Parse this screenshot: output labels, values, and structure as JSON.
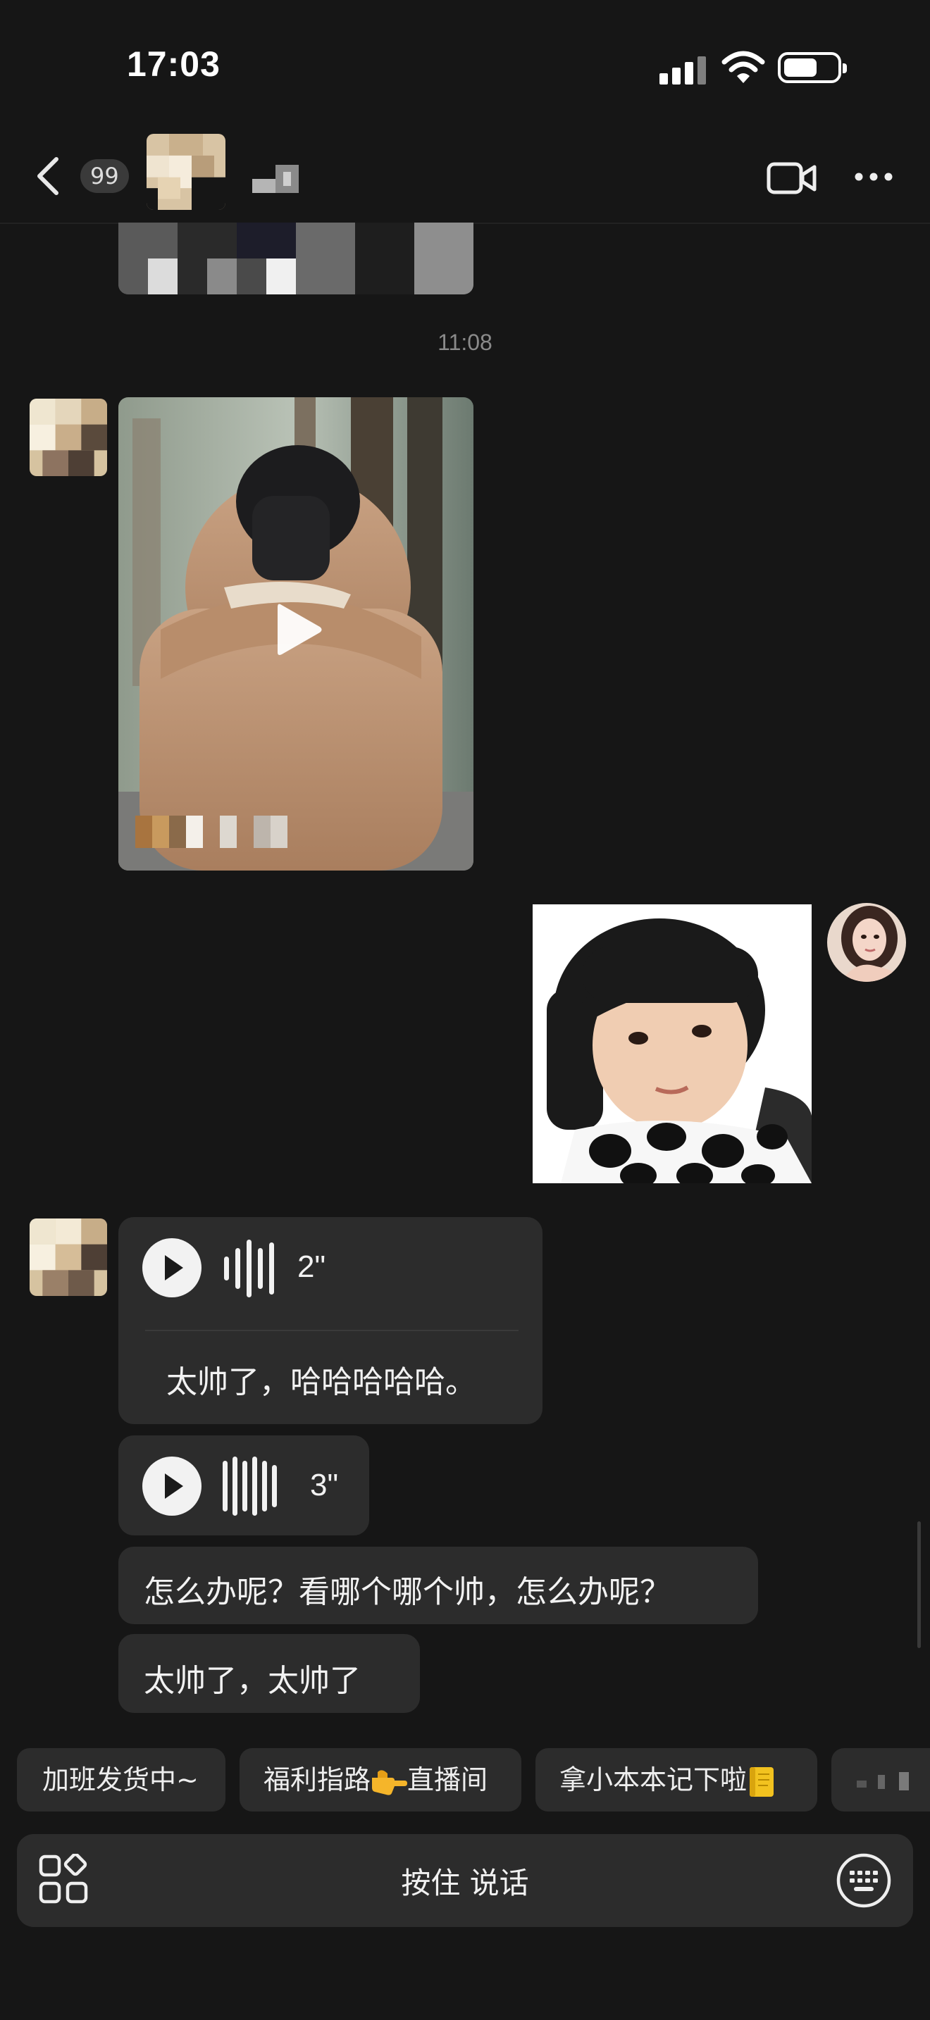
{
  "status_bar": {
    "time": "17:03"
  },
  "header": {
    "unread_count": "99"
  },
  "chat": {
    "timestamp": "11:08",
    "voice_1": {
      "duration": "2\"",
      "transcript": "太帅了，哈哈哈哈哈。"
    },
    "voice_2": {
      "duration": "3\""
    },
    "text_1": "怎么办呢？看哪个哪个帅，怎么办呢？",
    "text_2": "太帅了，太帅了"
  },
  "quick_replies": [
    {
      "label": "加班发货中~"
    },
    {
      "label": "福利指路",
      "label_after": "直播间",
      "emoji": "pointing-hand-icon"
    },
    {
      "label": "拿小本本记下啦",
      "emoji": "notebook-icon"
    }
  ],
  "input_bar": {
    "hold_to_talk": "按住 说话"
  },
  "colors": {
    "background": "#161616",
    "bubble": "#2c2c2c",
    "text": "#f2f2f2",
    "timestamp": "#8a8a8a"
  }
}
